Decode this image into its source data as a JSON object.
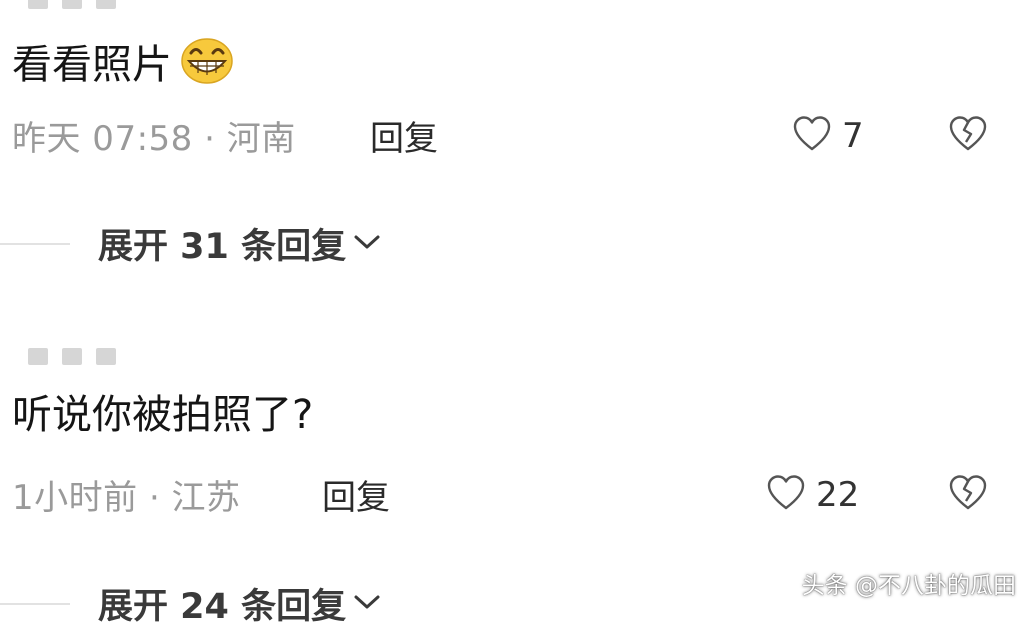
{
  "comments": [
    {
      "text": "看看照片",
      "emoji": "grinning-face-emoji",
      "meta": "昨天 07:58 · 河南",
      "reply_label": "回复",
      "likes": "7",
      "expand_label": "展开 31 条回复"
    },
    {
      "text": "听说你被拍照了?",
      "meta": "1小时前 · 江苏",
      "reply_label": "回复",
      "likes": "22",
      "expand_label": "展开 24 条回复"
    }
  ],
  "icons": {
    "like": "heart-outline-icon",
    "dislike": "broken-heart-icon",
    "expand": "chevron-down-icon"
  },
  "colors": {
    "emoji_yellow": "#f7c93c",
    "meta_gray": "#9a9a9a",
    "watermark": "#ffffff"
  },
  "watermark": "头条 @不八卦的瓜田"
}
